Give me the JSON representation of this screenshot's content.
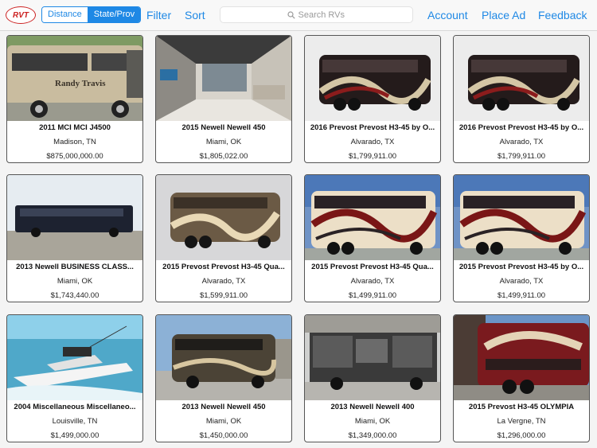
{
  "header": {
    "logo_text": "RVT",
    "segments": [
      {
        "label": "Distance",
        "active": false
      },
      {
        "label": "State/Prov",
        "active": true
      }
    ],
    "filter_label": "Filter",
    "sort_label": "Sort",
    "search_placeholder": "Search RVs",
    "account_label": "Account",
    "place_ad_label": "Place Ad",
    "feedback_label": "Feedback",
    "accent_color": "#1e88e5"
  },
  "listings": [
    {
      "title": "2011 MCI MCI J4500",
      "location": "Madison, TN",
      "price": "$875,000,000.00",
      "photo": "tan-coach",
      "photo_text": "Randy Travis"
    },
    {
      "title": "2015 Newell Newell 450",
      "location": "Miami, OK",
      "price": "$1,805,022.00",
      "photo": "interior"
    },
    {
      "title": "2016 Prevost Prevost H3-45 by O...",
      "location": "Alvarado, TX",
      "price": "$1,799,911.00",
      "photo": "black-swirl"
    },
    {
      "title": "2016 Prevost Prevost H3-45 by O...",
      "location": "Alvarado, TX",
      "price": "$1,799,911.00",
      "photo": "black-swirl"
    },
    {
      "title": "2013 Newell  BUSINESS CLASS...",
      "location": "Miami, OK",
      "price": "$1,743,440.00",
      "photo": "black-bus-sky"
    },
    {
      "title": "2015 Prevost Prevost H3-45 Qua...",
      "location": "Alvarado, TX",
      "price": "$1,599,911.00",
      "photo": "brown-gold"
    },
    {
      "title": "2015 Prevost Prevost H3-45 Qua...",
      "location": "Alvarado, TX",
      "price": "$1,499,911.00",
      "photo": "cream-swirl"
    },
    {
      "title": "2015 Prevost Prevost H3-45 by O...",
      "location": "Alvarado, TX",
      "price": "$1,499,911.00",
      "photo": "cream-swirl"
    },
    {
      "title": "2004 Miscellaneous Miscellaneo...",
      "location": "Louisville, TN",
      "price": "$1,499,000.00",
      "photo": "boat"
    },
    {
      "title": "2013 Newell Newell 450",
      "location": "Miami, OK",
      "price": "$1,450,000.00",
      "photo": "newell-lot"
    },
    {
      "title": "2013 Newell Newell 400",
      "location": "Miami, OK",
      "price": "$1,349,000.00",
      "photo": "slideouts"
    },
    {
      "title": "2015 Prevost  H3-45 OLYMPIA",
      "location": "La Vergne, TN",
      "price": "$1,296,000.00",
      "photo": "red-rear"
    }
  ]
}
